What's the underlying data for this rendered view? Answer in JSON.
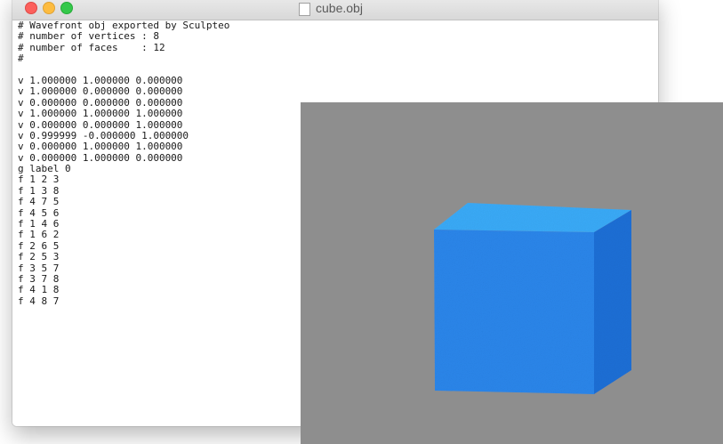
{
  "editor_window": {
    "title": "cube.obj",
    "traffic_lights": [
      "close-button",
      "minimize-button",
      "zoom-button"
    ],
    "file_lines": [
      "# Wavefront obj exported by Sculpteo",
      "# number of vertices : 8",
      "# number of faces    : 12",
      "#",
      "",
      "v 1.000000 1.000000 0.000000",
      "v 1.000000 0.000000 0.000000",
      "v 0.000000 0.000000 0.000000",
      "v 1.000000 1.000000 1.000000",
      "v 0.000000 0.000000 1.000000",
      "v 0.999999 -0.000000 1.000000",
      "v 0.000000 1.000000 1.000000",
      "v 0.000000 1.000000 0.000000",
      "g label 0",
      "f 1 2 3",
      "f 1 3 8",
      "f 4 7 5",
      "f 4 5 6",
      "f 1 4 6",
      "f 1 6 2",
      "f 2 6 5",
      "f 2 5 3",
      "f 3 5 7",
      "f 3 7 8",
      "f 4 1 8",
      "f 4 8 7"
    ]
  },
  "viewer_3d": {
    "background_color": "#8e8e8e",
    "object": "cube",
    "face_colors": {
      "front": "#2a86ea",
      "top": "#3aaaf7",
      "side": "#1f6fd6"
    }
  }
}
